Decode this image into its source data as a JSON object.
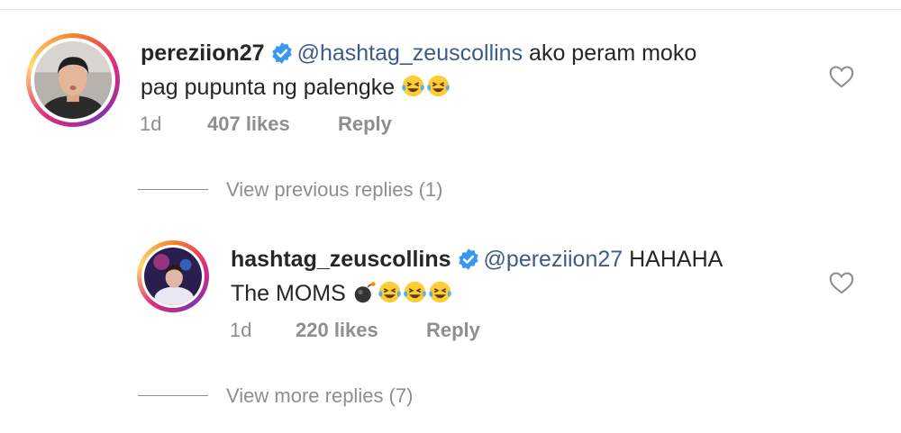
{
  "comments": [
    {
      "username": "pereziion27",
      "mention": "@hashtag_zeuscollins",
      "text_line1": " ako peram moko",
      "text_line2": "pag pupunta ng palengke",
      "emojis": [
        "laughing-crying",
        "laughing-crying"
      ],
      "time": "1d",
      "likes": "407 likes",
      "reply_label": "Reply",
      "replies_label": "View previous replies (1)"
    },
    {
      "username": "hashtag_zeuscollins",
      "mention": "@pereziion27",
      "text_line1": " HAHAHA",
      "text_line2": "The MOMS",
      "emojis": [
        "bomb",
        "laughing-crying",
        "laughing-crying",
        "laughing-crying"
      ],
      "time": "1d",
      "likes": "220 likes",
      "reply_label": "Reply",
      "replies_label": "View more replies (7)"
    }
  ],
  "colors": {
    "mention": "#3c5b8a",
    "verified": "#3897f0",
    "meta": "#8e8e8e"
  },
  "icons": [
    "verified-badge-icon",
    "heart-icon",
    "laughing-crying-emoji",
    "bomb-emoji"
  ]
}
